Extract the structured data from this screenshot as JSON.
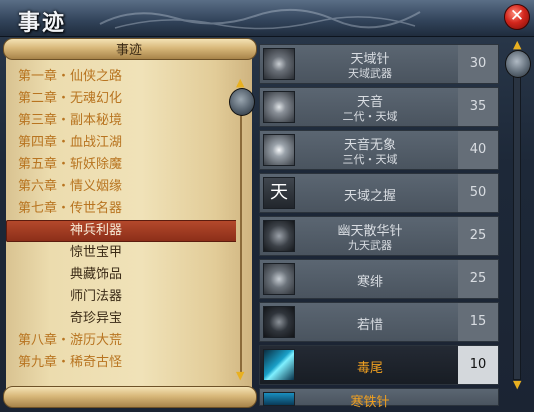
{
  "window": {
    "title": "事迹",
    "close_label": "✕"
  },
  "scroll": {
    "title": "事迹",
    "chapters": [
      {
        "label": "第一章・仙侠之路",
        "level": "chapter"
      },
      {
        "label": "第二章・无魂幻化",
        "level": "chapter"
      },
      {
        "label": "第三章・副本秘境",
        "level": "chapter"
      },
      {
        "label": "第四章・血战江湖",
        "level": "chapter"
      },
      {
        "label": "第五章・斩妖除魔",
        "level": "chapter"
      },
      {
        "label": "第六章・情义姻缘",
        "level": "chapter"
      },
      {
        "label": "第七章・传世名器",
        "level": "chapter"
      },
      {
        "label": "神兵利器",
        "level": "sub",
        "selected": true
      },
      {
        "label": "惊世宝甲",
        "level": "sub"
      },
      {
        "label": "典藏饰品",
        "level": "sub"
      },
      {
        "label": "师门法器",
        "level": "sub"
      },
      {
        "label": "奇珍异宝",
        "level": "sub"
      },
      {
        "label": "第八章・游历大荒",
        "level": "chapter"
      },
      {
        "label": "第九章・稀奇古怪",
        "level": "chapter"
      }
    ],
    "scroll_up": "▲",
    "scroll_down": "▼"
  },
  "items": [
    {
      "name": "天域针",
      "sub": "天域武器",
      "level": "30",
      "icon": "needle-orb-icon"
    },
    {
      "name": "天音",
      "sub": "二代・天域",
      "level": "35",
      "icon": "sound-orb-icon"
    },
    {
      "name": "天音无象",
      "sub": "三代・天域",
      "level": "40",
      "icon": "burst-icon"
    },
    {
      "name": "天域之握",
      "sub": "",
      "level": "50",
      "icon": "tian-glyph-icon",
      "glyph": "天"
    },
    {
      "name": "幽天散华针",
      "sub": "九天武器",
      "level": "25",
      "icon": "claw-emblem-icon"
    },
    {
      "name": "寒绯",
      "sub": "",
      "level": "25",
      "icon": "frost-orb-icon"
    },
    {
      "name": "若惜",
      "sub": "",
      "level": "15",
      "icon": "dark-orb-icon"
    },
    {
      "name": "毒尾",
      "sub": "",
      "level": "10",
      "icon": "lightning-tail-icon",
      "highlighted": true
    },
    {
      "name": "寒铁针",
      "sub": "",
      "level": "",
      "icon": "needle-icon",
      "partial": true
    }
  ],
  "right_scroll": {
    "up": "▲",
    "down": "▼"
  }
}
